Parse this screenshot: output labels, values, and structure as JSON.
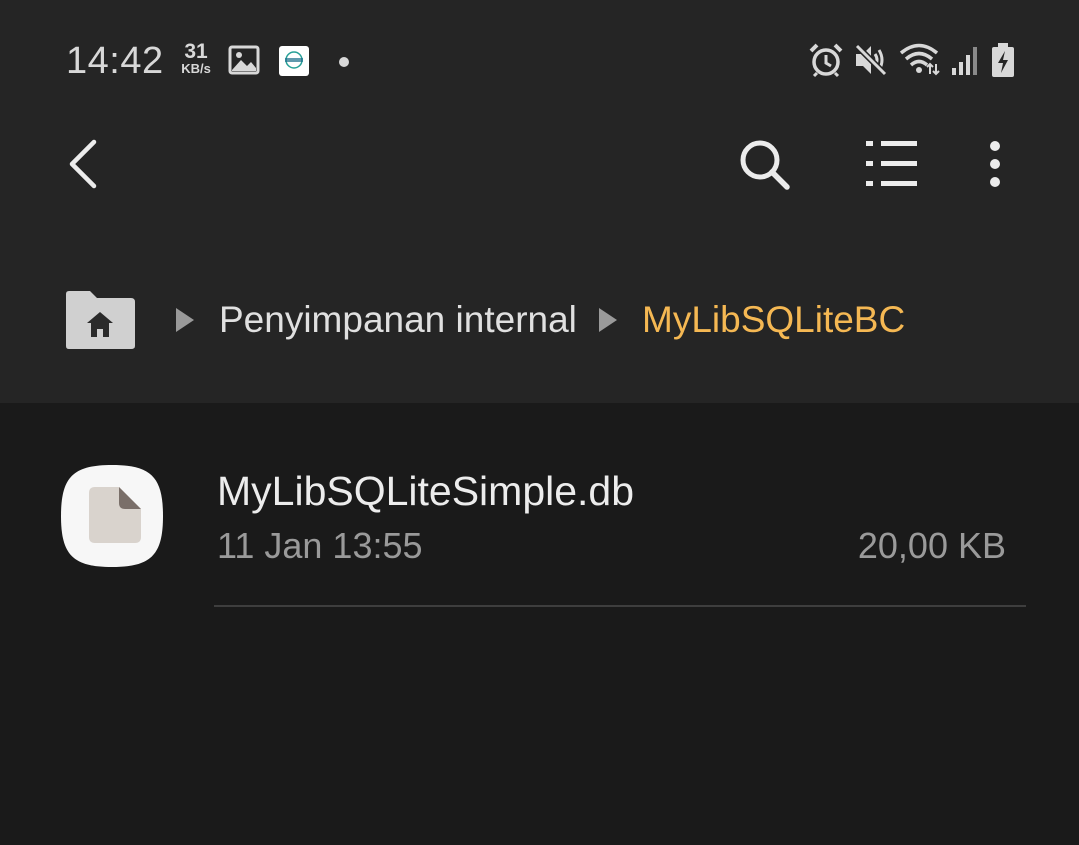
{
  "status_bar": {
    "time": "14:42",
    "net_speed_value": "31",
    "net_speed_unit": "KB/s",
    "icons": [
      "image-notification-icon",
      "app-notification-icon",
      "dot-icon",
      "alarm-icon",
      "mute-icon",
      "wifi-icon",
      "signal-icon",
      "battery-charging-icon"
    ]
  },
  "app_bar": {
    "icons": [
      "back-icon",
      "search-icon",
      "list-view-icon",
      "more-options-icon"
    ]
  },
  "breadcrumb": {
    "home_icon": "home-folder-icon",
    "items": [
      "Penyimpanan internal",
      "MyLibSQLiteBC"
    ],
    "active_color": "#f5b853"
  },
  "files": [
    {
      "name": "MyLibSQLiteSimple.db",
      "date": "11 Jan 13:55",
      "size": "20,00 KB",
      "icon": "generic-file-icon"
    }
  ]
}
